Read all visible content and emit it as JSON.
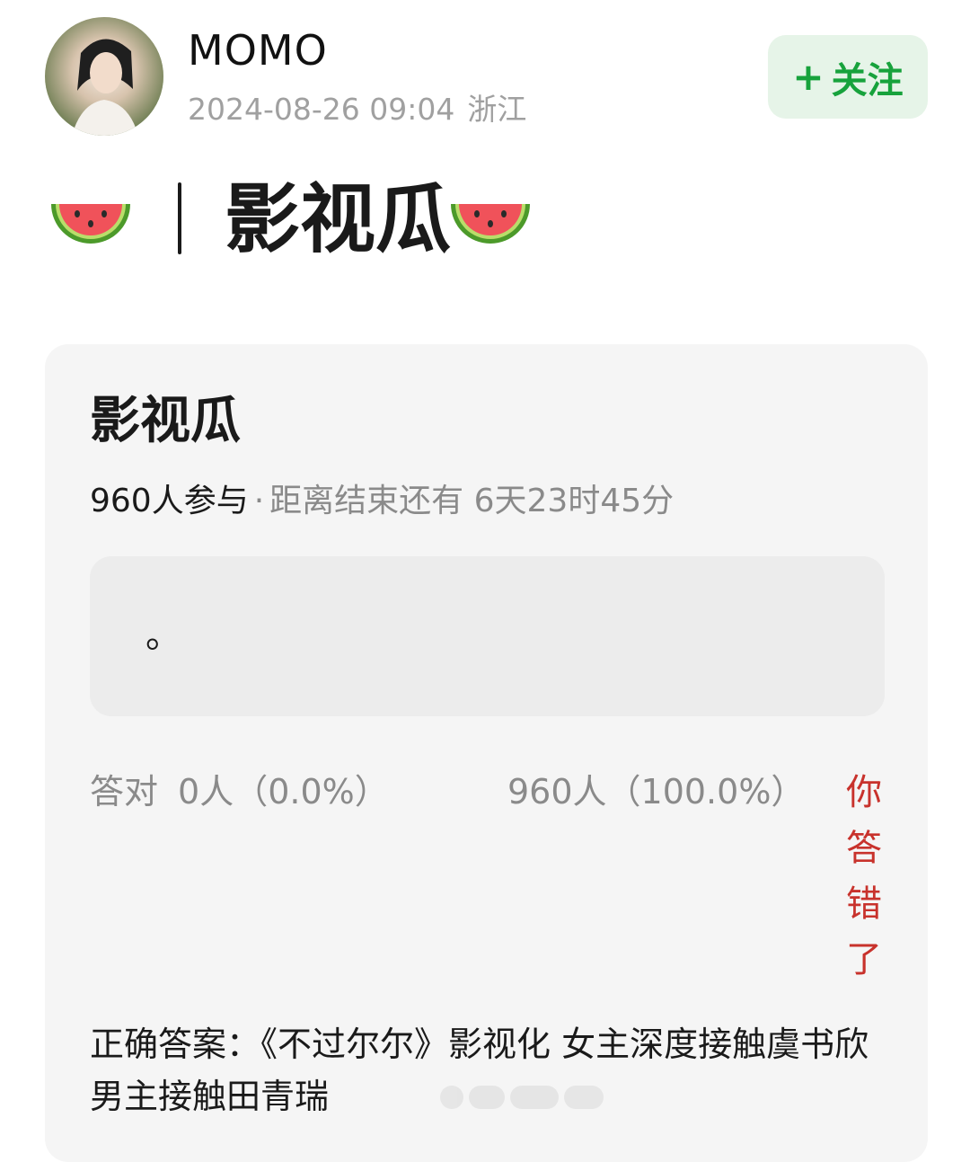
{
  "header": {
    "username": "MOMO",
    "timestamp": "2024-08-26 09:04",
    "location": "浙江",
    "follow_plus": "+",
    "follow_label": "关注"
  },
  "post": {
    "title": "影视瓜",
    "title_icon": "watermelon-icon"
  },
  "quiz": {
    "title": "影视瓜",
    "participants": "960人参与",
    "separator": "·",
    "countdown": "距离结束还有 6天23时45分",
    "option_text": "。",
    "correct_label": "答对",
    "correct_count": "0人（0.0%）",
    "wrong_count": "960人（100.0%）",
    "wrong_badge": "你答错了",
    "answer": "正确答案：《不过尔尔》影视化 女主深度接触虞书欣 男主接触田青瑞"
  },
  "colors": {
    "follow_bg": "#e6f4e8",
    "follow_text": "#17a23c",
    "wrong": "#c8322c",
    "card_bg": "#f5f5f5"
  }
}
